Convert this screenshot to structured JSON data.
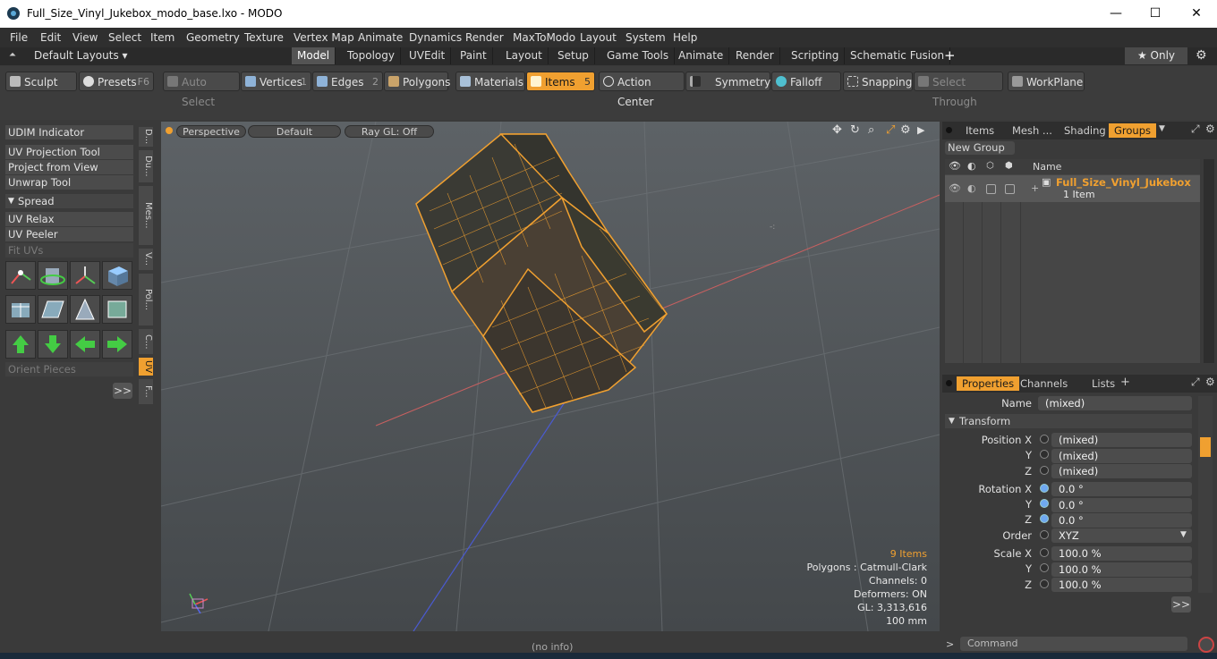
{
  "window": {
    "title": "Full_Size_Vinyl_Jukebox_modo_base.lxo - MODO",
    "minimize": "—",
    "maximize": "☐",
    "close": "✕"
  },
  "menu": [
    "File",
    "Edit",
    "View",
    "Select",
    "Item",
    "Geometry",
    "Texture",
    "Vertex Map",
    "Animate",
    "Dynamics",
    "Render",
    "MaxToModo",
    "Layout",
    "System",
    "Help"
  ],
  "layouts": {
    "default_layouts": "Default Layouts ▾",
    "tabs": [
      "Model",
      "Topology",
      "UVEdit",
      "Paint",
      "Layout",
      "Setup",
      "Game Tools",
      "Animate",
      "Render",
      "Scripting",
      "Schematic Fusion"
    ],
    "active_tab": "Model",
    "add": "+",
    "only": "★  Only",
    "gear": "⚙"
  },
  "toolbar": {
    "sculpt": "Sculpt",
    "presets": "Presets",
    "presets_key": "F6",
    "auto_select": "Auto Select",
    "vertices": "Vertices",
    "vertices_num": "1",
    "edges": "Edges",
    "edges_num": "2",
    "polygons": "Polygons",
    "materials": "Materials",
    "items": "Items",
    "items_num": "5",
    "action_center": "Action Center",
    "symmetry": "Symmetry",
    "falloff": "Falloff",
    "snapping": "Snapping",
    "select_through": "Select Through",
    "workplane": "WorkPlane"
  },
  "left_panel": {
    "buttons": [
      "UDIM Indicator",
      "UV Projection Tool",
      "Project from View",
      "Unwrap Tool"
    ],
    "spread": "Spread",
    "buttons2": [
      "UV Relax",
      "UV Peeler"
    ],
    "fit_uvs": "Fit UVs",
    "orient_pieces": "Orient Pieces",
    "more": ">>",
    "vtabs": [
      "D...",
      "Du...",
      "Mes...",
      "V...",
      "Pol...",
      "C...",
      "UV",
      "F..."
    ]
  },
  "viewport": {
    "perspective": "Perspective",
    "default": "Default",
    "raygl": "Ray GL: Off",
    "info": {
      "items": "9 Items",
      "polygons": "Polygons : Catmull-Clark",
      "channels": "Channels: 0",
      "deformers": "Deformers: ON",
      "gl": "GL: 3,313,616",
      "scale": "100 mm"
    }
  },
  "status": {
    "no_info": "(no info)"
  },
  "items_panel": {
    "tabs": [
      "Items",
      "Mesh ...",
      "Shading",
      "Groups"
    ],
    "active_tab": "Groups",
    "new_group": "New Group",
    "col_name": "Name",
    "group_name": "Full_Size_Vinyl_Jukebox",
    "group_count": "1 Item"
  },
  "properties": {
    "tabs": [
      "Properties",
      "Channels",
      "Lists"
    ],
    "add": "+",
    "name_label": "Name",
    "name_value": "(mixed)",
    "transform": "Transform",
    "position_label": "Position X",
    "position": [
      "(mixed)",
      "(mixed)",
      "(mixed)"
    ],
    "rotation_label": "Rotation X",
    "rotation": [
      "0.0 °",
      "0.0 °",
      "0.0 °"
    ],
    "order_label": "Order",
    "order_value": "XYZ",
    "scale_label": "Scale X",
    "scale": [
      "100.0 %",
      "100.0 %",
      "100.0 %"
    ],
    "y": "Y",
    "z": "Z",
    "more": ">>",
    "command": "Command"
  },
  "colors": {
    "accent": "#f0a030",
    "wire": "#f0a030"
  }
}
